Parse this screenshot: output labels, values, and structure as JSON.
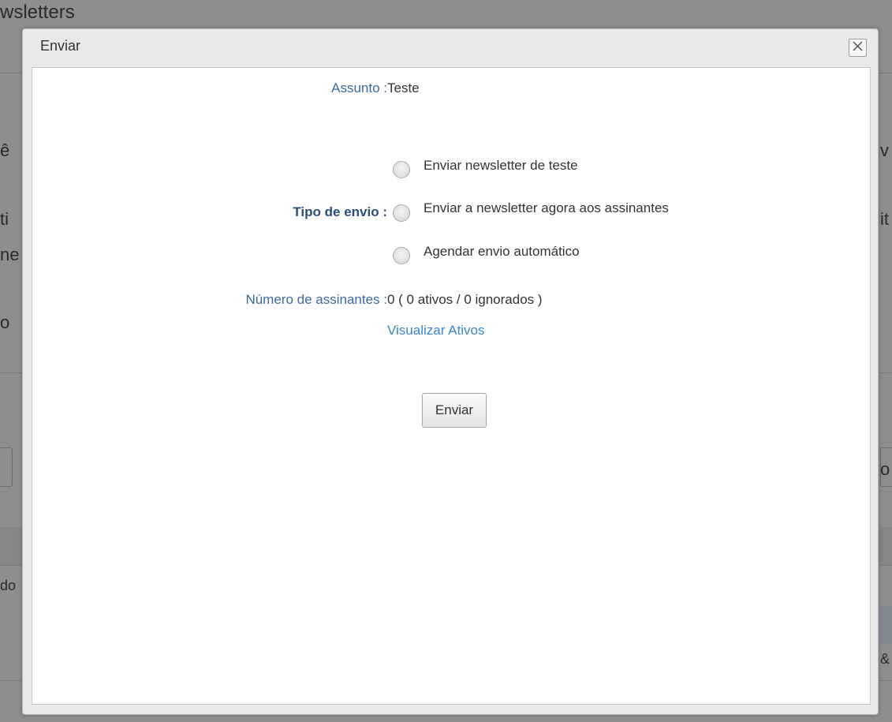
{
  "background": {
    "title_fragment": "wsletters",
    "side_fragments": [
      "ê",
      "ti",
      "ne",
      "o",
      "do",
      "v",
      "it",
      "o",
      "&"
    ]
  },
  "dialog": {
    "title": "Enviar",
    "close_icon": "close-icon",
    "subject_label": "Assunto :",
    "subject_value": "Teste",
    "send_type_label": "Tipo de envio :",
    "send_options": [
      {
        "label": "Enviar newsletter de teste",
        "selected": false
      },
      {
        "label": "Enviar a newsletter agora aos assinantes",
        "selected": false
      },
      {
        "label": "Agendar envio automático",
        "selected": false
      }
    ],
    "subscribers_label": "Número de assinantes :",
    "subscribers_value": "0 ( 0 ativos / 0 ignorados )",
    "view_active_link": "Visualizar Ativos",
    "submit_label": "Enviar"
  },
  "colors": {
    "overlay": "#8e8e8e",
    "label_blue": "#3a6aa0",
    "label_bold_blue": "#2b4f7c",
    "link_blue": "#3a86c8"
  }
}
